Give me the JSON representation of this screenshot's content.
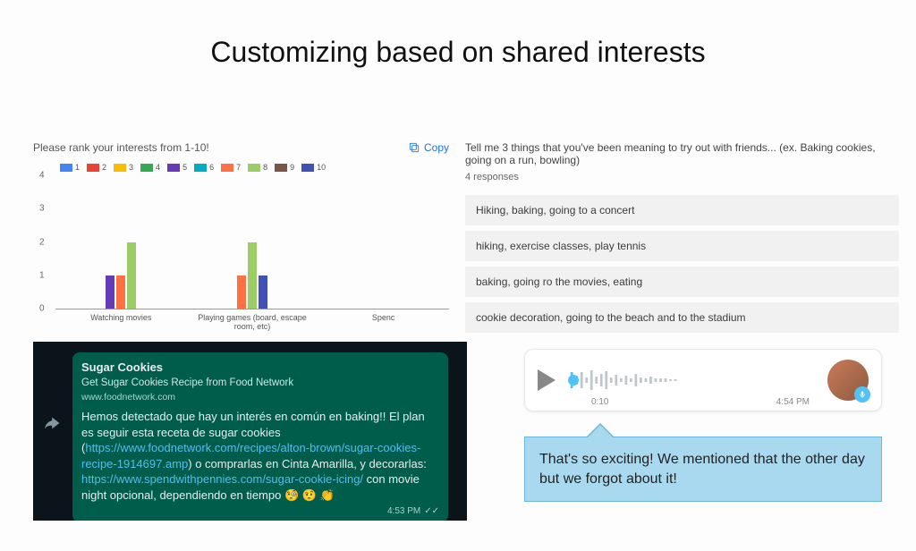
{
  "title": "Customizing based on shared interests",
  "chart": {
    "question": "Please rank your interests from 1-10!",
    "copy_label": "Copy"
  },
  "chart_data": {
    "type": "bar",
    "title": "Please rank your interests from 1-10!",
    "xlabel": "",
    "ylabel": "",
    "ylim": [
      0,
      4
    ],
    "yticks": [
      0,
      1,
      2,
      3,
      4
    ],
    "categories": [
      "Watching movies",
      "Playing games (board, escape room, etc)",
      "Spenc"
    ],
    "series": [
      {
        "name": "1",
        "color": "#4285f4",
        "values": [
          0,
          0,
          0
        ]
      },
      {
        "name": "2",
        "color": "#ea4335",
        "values": [
          0,
          0,
          0
        ]
      },
      {
        "name": "3",
        "color": "#fbbc04",
        "values": [
          0,
          0,
          0
        ]
      },
      {
        "name": "4",
        "color": "#34a853",
        "values": [
          0,
          0,
          0
        ]
      },
      {
        "name": "5",
        "color": "#673ab7",
        "values": [
          1,
          0,
          0
        ]
      },
      {
        "name": "6",
        "color": "#00acc1",
        "values": [
          0,
          0,
          0
        ]
      },
      {
        "name": "7",
        "color": "#ff7043",
        "values": [
          1,
          1,
          0
        ]
      },
      {
        "name": "8",
        "color": "#9ccc65",
        "values": [
          2,
          2,
          0
        ]
      },
      {
        "name": "9",
        "color": "#795548",
        "values": [
          0,
          0,
          0
        ]
      },
      {
        "name": "10",
        "color": "#3f51b5",
        "values": [
          0,
          1,
          0
        ]
      }
    ]
  },
  "responses": {
    "question": "Tell me 3 things that you've been meaning to try out with friends... (ex. Baking cookies, going on a run, bowling)",
    "count_label": "4 responses",
    "items": [
      "Hiking, baking, going to a concert",
      "hiking, exercise classes, play tennis",
      "baking, going ro the movies, eating",
      "cookie decoration, going to the beach and to the stadium"
    ]
  },
  "wa": {
    "preview_title": "Sugar Cookies",
    "preview_sub": "Get Sugar Cookies Recipe from Food Network",
    "preview_domain": "www.foodnetwork.com",
    "msg1": "Hemos detectado que hay un interés en común en baking!! El plan es seguir esta receta de sugar cookies (",
    "link1": "https://www.foodnetwork.com/recipes/alton-brown/sugar-cookies-recipe-1914697.amp",
    "msg2": ") o comprarlas en Cinta Amarilla, y decorarlas: ",
    "link2": "https://www.spendwithpennies.com/sugar-cookie-icing/",
    "msg3": " con movie night opcional, dependiendo en tiempo 🧐 🤨 👏",
    "timestamp": "4:53 PM"
  },
  "voice": {
    "elapsed": "0:10",
    "time": "4:54 PM"
  },
  "callout": "That's so exciting! We mentioned that the other day but we forgot about it!"
}
